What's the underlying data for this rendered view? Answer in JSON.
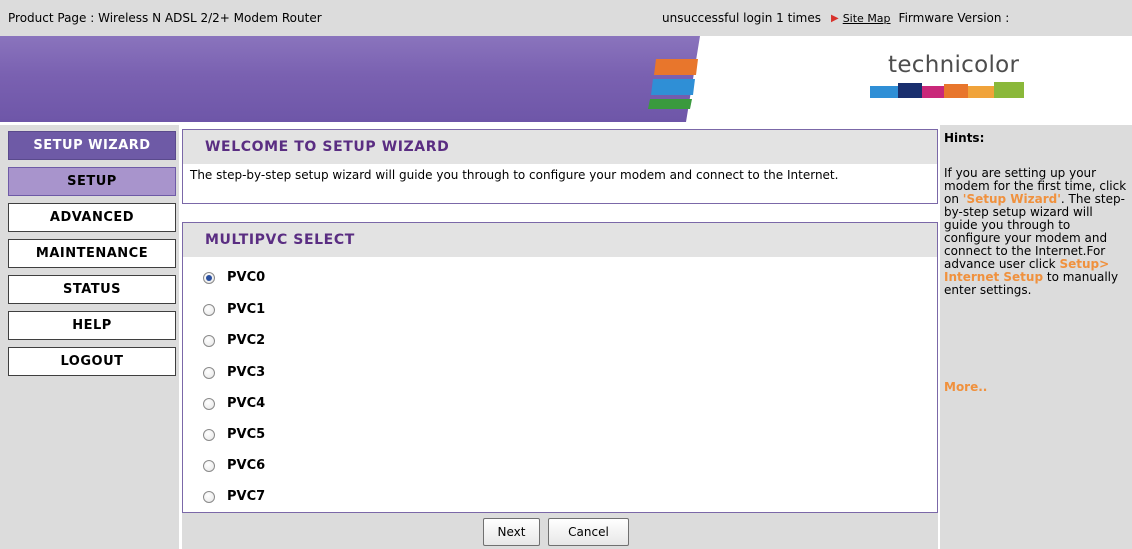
{
  "topbar": {
    "product": "Product Page : Wireless N ADSL 2/2+ Modem Router",
    "login_status": "unsuccessful login 1 times",
    "site_map": "Site Map",
    "firmware": "Firmware Version :"
  },
  "banner": {
    "logo_text": "technicolor",
    "stripe_colors": [
      "#e8762c",
      "#2f8fd6",
      "#3a9a3e"
    ]
  },
  "nav": {
    "items": [
      {
        "label": "SETUP WIZARD"
      },
      {
        "label": "SETUP"
      },
      {
        "label": "ADVANCED"
      },
      {
        "label": "MAINTENANCE"
      },
      {
        "label": "STATUS"
      },
      {
        "label": "HELP"
      },
      {
        "label": "LOGOUT"
      }
    ]
  },
  "welcome": {
    "title": "WELCOME TO SETUP WIZARD",
    "text": "The step-by-step setup wizard will guide you through to configure your modem and connect to the Internet."
  },
  "multipvc": {
    "title": "MULTIPVC SELECT",
    "selected": "PVC0",
    "options": [
      "PVC0",
      "PVC1",
      "PVC2",
      "PVC3",
      "PVC4",
      "PVC5",
      "PVC6",
      "PVC7"
    ]
  },
  "buttons": {
    "next": "Next",
    "cancel": "Cancel"
  },
  "hints": {
    "title": "Hints:",
    "text_1": "If you are setting up your modem for the first time, click on ",
    "link_1": "'Setup Wizard'",
    "text_2": ". The step-by-step setup wizard will guide you through to configure your modem and connect to the Internet.For advance user click ",
    "link_2": "Setup> Internet Setup",
    "text_3": " to manually enter settings.",
    "more": "More.."
  }
}
